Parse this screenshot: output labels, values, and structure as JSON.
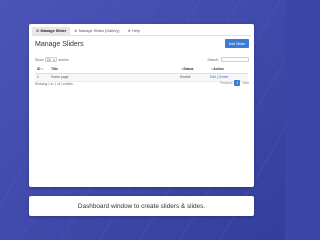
{
  "colors": {
    "background": "#3c46a8",
    "accent": "#3a7bd5",
    "panel": "#ffffff"
  },
  "tabs": [
    {
      "icon": "gear-icon",
      "label": "Manage Slider",
      "active": true
    },
    {
      "icon": "gear-icon",
      "label": "Manage Slides (Gallery)",
      "active": false
    },
    {
      "icon": "gear-icon",
      "label": "Help",
      "active": false
    }
  ],
  "header": {
    "title": "Manage Sliders",
    "add_button": "Add Slider"
  },
  "controls": {
    "show_label": "Show",
    "page_size": "10",
    "entries_label": "entries",
    "search_label": "Search:"
  },
  "table": {
    "columns": [
      "ID",
      "Title",
      "Status",
      "Action"
    ],
    "rows": [
      {
        "id": "1",
        "title": "Home page",
        "status": "Enable",
        "edit": "Edit",
        "delete": "Delete"
      }
    ]
  },
  "footer": {
    "info": "Showing 1 to 1 of 1 entries",
    "previous": "Previous",
    "current_page": "1",
    "next": "Next"
  },
  "caption": "Dashboard window to create sliders & slides."
}
